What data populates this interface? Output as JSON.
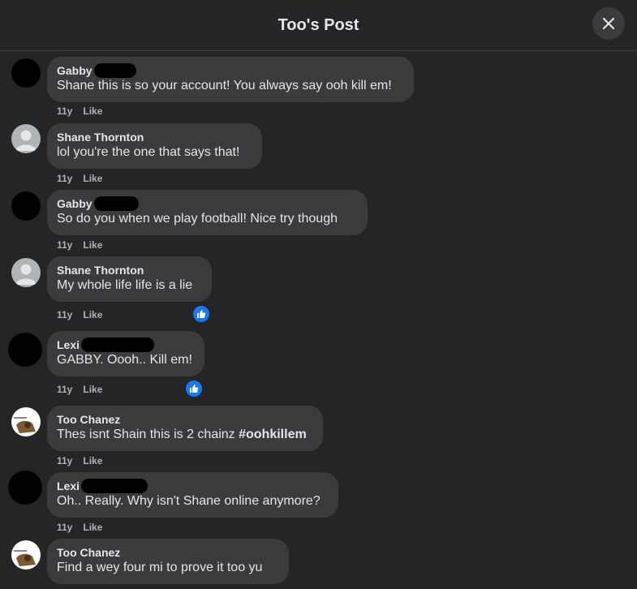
{
  "header": {
    "title": "Too's Post"
  },
  "comments": [
    {
      "author": "Gabby",
      "text": "Shane this is so your account! You always say ooh kill em!",
      "time": "11y",
      "like": "Like"
    },
    {
      "author": "Shane Thornton",
      "text": "lol you're the one that says that!",
      "time": "11y",
      "like": "Like"
    },
    {
      "author": "Gabby",
      "text": "So do you when we play football! Nice try though",
      "time": "11y",
      "like": "Like"
    },
    {
      "author": "Shane Thornton",
      "text": "My whole life life is a lie",
      "time": "11y",
      "like": "Like"
    },
    {
      "author": "Lexi",
      "text": "GABBY. Oooh.. Kill em!",
      "time": "11y",
      "like": "Like"
    },
    {
      "author": "Too Chanez",
      "text_prefix": "Thes isnt Shain this is 2 chainz ",
      "hashtag": "#oohkillem",
      "time": "11y",
      "like": "Like"
    },
    {
      "author": "Lexi",
      "text": "Oh.. Really. Why isn't Shane online anymore?",
      "time": "11y",
      "like": "Like"
    },
    {
      "author": "Too Chanez",
      "text": "Find a wey four mi to prove it too yu",
      "time": "",
      "like": ""
    }
  ]
}
